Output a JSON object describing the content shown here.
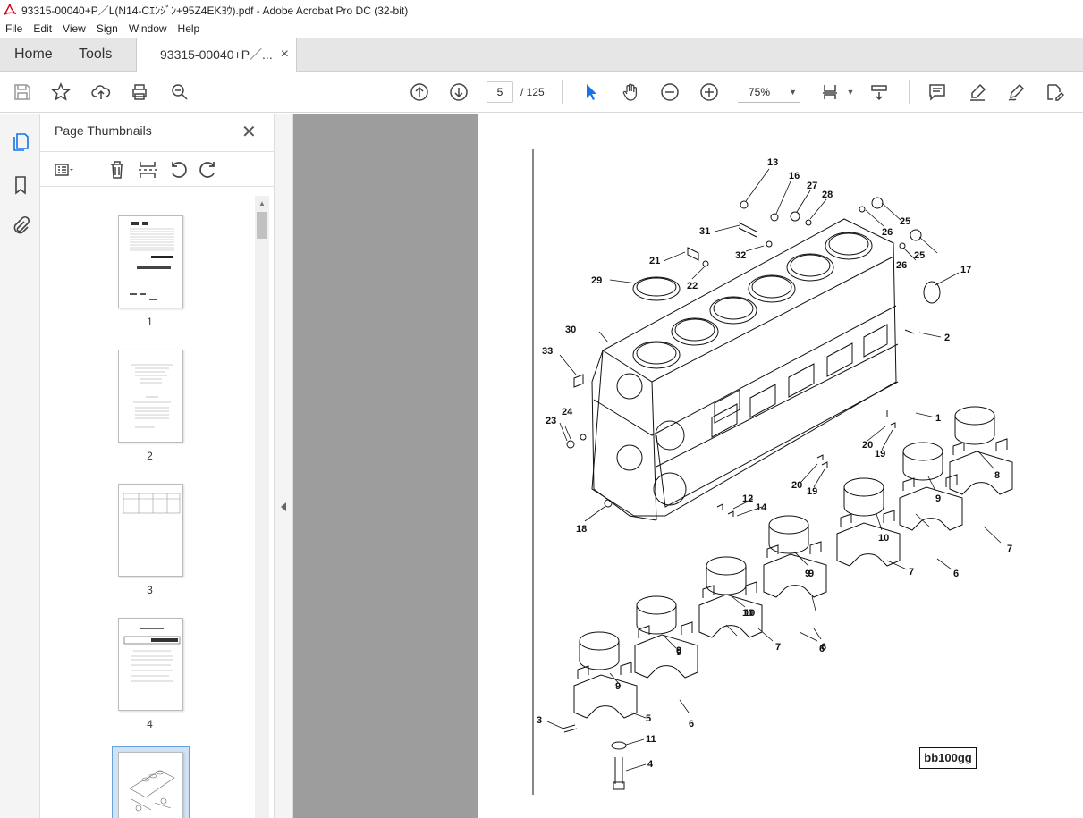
{
  "window": {
    "title": "93315-00040+P／L(N14-Cｴﾝｼﾞﾝ+95Z4EKﾖｳ).pdf - Adobe Acrobat Pro DC (32-bit)"
  },
  "menu": [
    "File",
    "Edit",
    "View",
    "Sign",
    "Window",
    "Help"
  ],
  "tabs": {
    "home": "Home",
    "tools": "Tools",
    "document": "93315-00040+P／...",
    "close": "×"
  },
  "toolbar": {
    "current_page": "5",
    "total_pages": "/ 125",
    "zoom": "75%"
  },
  "panel": {
    "title": "Page Thumbnails",
    "close": "✕",
    "thumbnails": [
      {
        "number": "1"
      },
      {
        "number": "2"
      },
      {
        "number": "3"
      },
      {
        "number": "4"
      }
    ]
  },
  "drawing": {
    "code": "bb100gg",
    "part_labels": [
      "13",
      "16",
      "27",
      "28",
      "25",
      "26",
      "26",
      "25",
      "17",
      "31",
      "32",
      "21",
      "22",
      "29",
      "30",
      "2",
      "33",
      "1",
      "24",
      "23",
      "20",
      "19",
      "8",
      "20",
      "19",
      "12",
      "14",
      "18",
      "9",
      "9",
      "10",
      "7",
      "7",
      "6",
      "10",
      "9",
      "6",
      "10",
      "9",
      "7",
      "6",
      "9",
      "9",
      "5",
      "6",
      "3",
      "11",
      "4"
    ]
  },
  "colors": {
    "accent": "#1473e6",
    "viewer_bg": "#9d9d9d",
    "tab_bg": "#e6e6e6"
  }
}
